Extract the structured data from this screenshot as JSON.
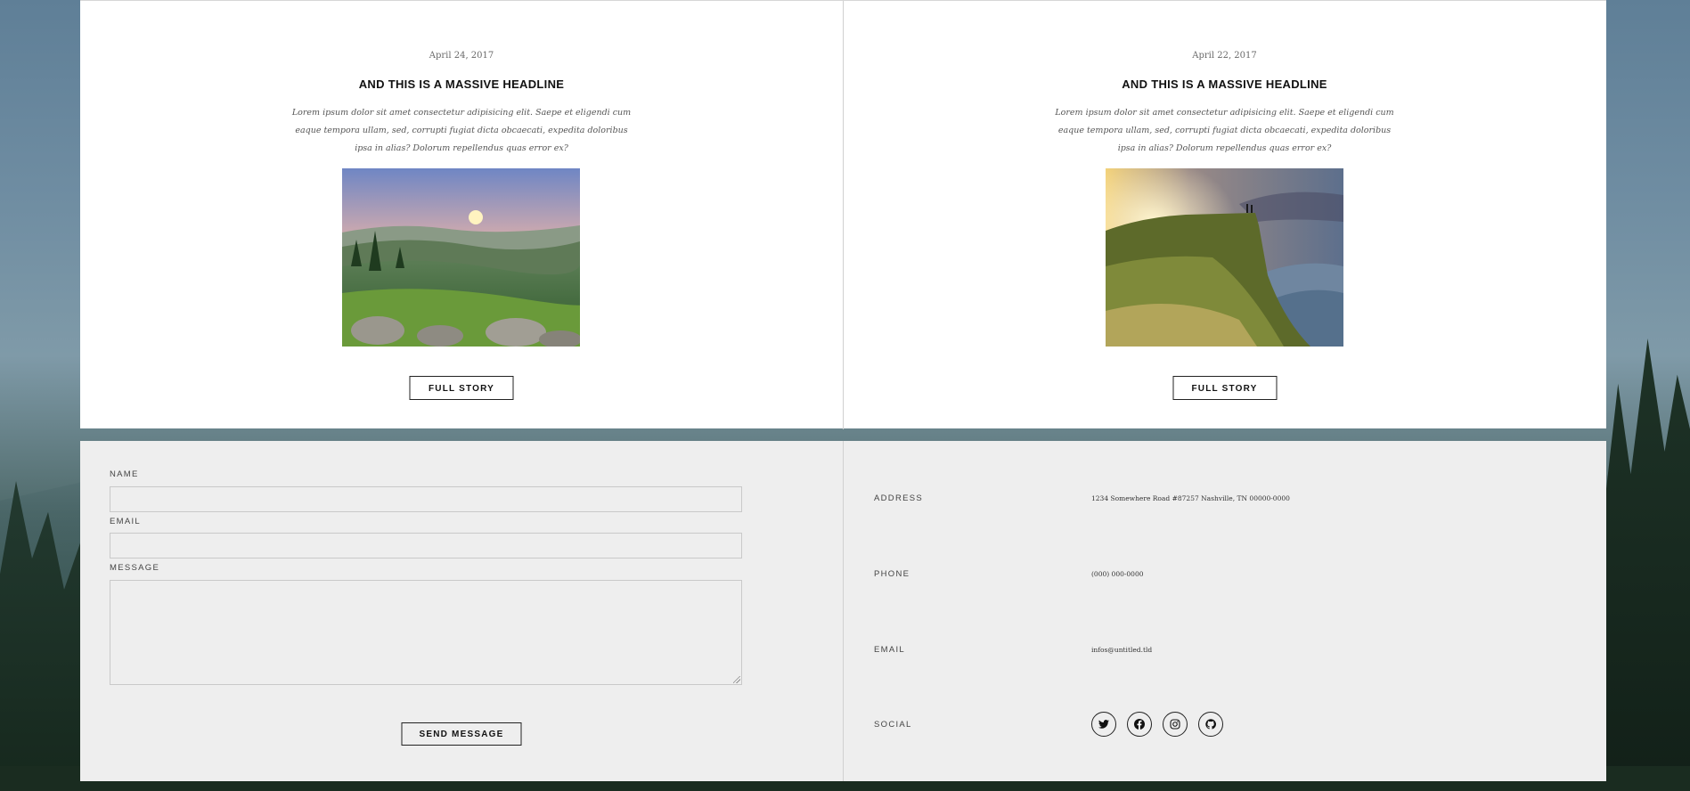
{
  "articles": [
    {
      "date": "April 24, 2017",
      "headline": "AND THIS IS A MASSIVE HEADLINE",
      "excerpt": "Lorem ipsum dolor sit amet consectetur adipisicing elit. Saepe et eligendi cum eaque tempora ullam, sed, corrupti fugiat dicta obcaecati, expedita doloribus ipsa in alias? Dolorum repellendus quas error ex?",
      "image": "sunset-valley-photo",
      "button": "FULL STORY"
    },
    {
      "date": "April 22, 2017",
      "headline": "AND THIS IS A MASSIVE HEADLINE",
      "excerpt": "Lorem ipsum dolor sit amet consectetur adipisicing elit. Saepe et eligendi cum eaque tempora ullam, sed, corrupti fugiat dicta obcaecati, expedita doloribus ipsa in alias? Dolorum repellendus quas error ex?",
      "image": "cliff-edge-photo",
      "button": "FULL STORY"
    }
  ],
  "form": {
    "name_label": "NAME",
    "email_label": "EMAIL",
    "message_label": "MESSAGE",
    "name_value": "",
    "email_value": "",
    "message_value": "",
    "submit_label": "SEND MESSAGE"
  },
  "info": {
    "address_label": "ADDRESS",
    "address_value": "1234 Somewhere Road #87257 Nashville, TN 00000-0000",
    "phone_label": "PHONE",
    "phone_value": "(000) 000-0000",
    "email_label": "EMAIL",
    "email_value": "infos@untitled.tld",
    "social_label": "SOCIAL",
    "social_icons": [
      "twitter-icon",
      "facebook-icon",
      "instagram-icon",
      "github-icon"
    ]
  },
  "colors": {
    "panel_white": "#ffffff",
    "panel_grey": "#eeeeee",
    "text_dark": "#111111",
    "border": "#222222"
  }
}
